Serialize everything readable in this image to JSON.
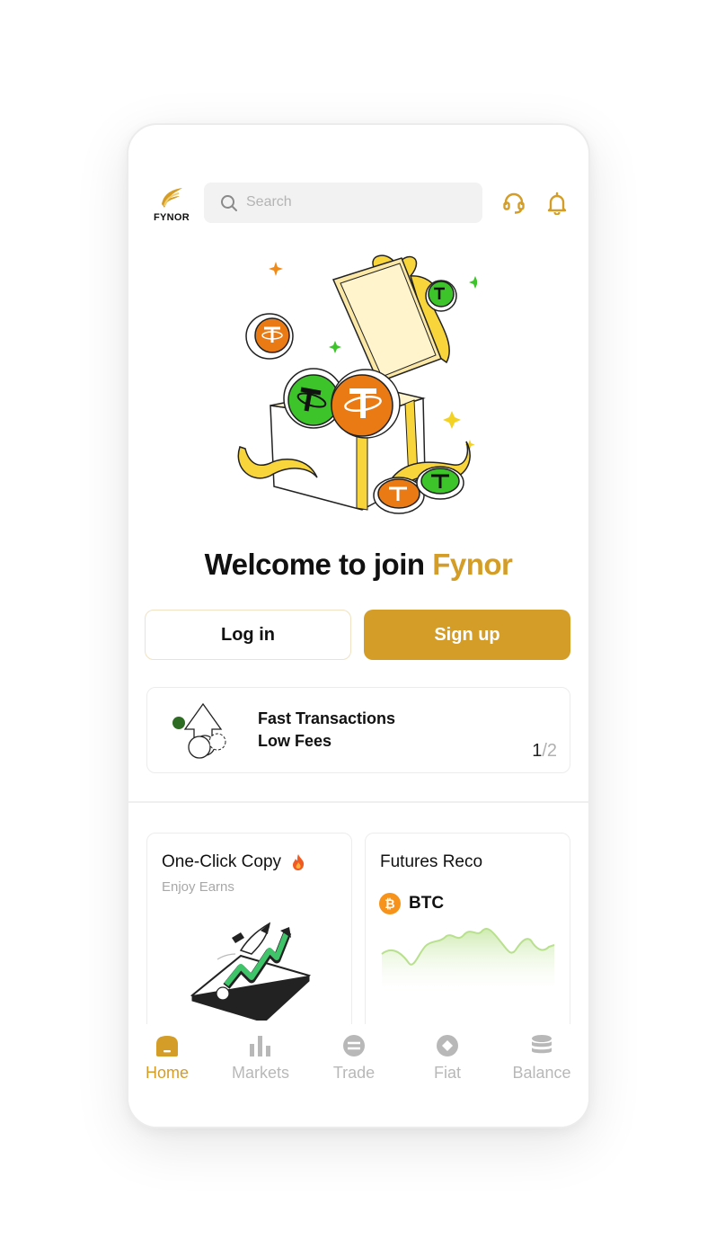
{
  "app": {
    "logo_text": "FYNOR"
  },
  "search": {
    "placeholder": "Search",
    "icon": "search-icon"
  },
  "header_icons": [
    "headset-icon",
    "bell-icon"
  ],
  "welcome": {
    "prefix": "Welcome to join ",
    "brand": "Fynor"
  },
  "buttons": {
    "login": "Log in",
    "signup": "Sign up"
  },
  "promo": {
    "line1": "Fast Transactions",
    "line2": "Low Fees",
    "page_current": "1",
    "page_total": "/2"
  },
  "cards": {
    "copy": {
      "title": "One-Click Copy",
      "subtitle": "Enjoy Earns"
    },
    "futures": {
      "title": "Futures Reco",
      "coin": "BTC"
    }
  },
  "tabs": [
    {
      "label": "Home",
      "icon": "home-icon",
      "active": true
    },
    {
      "label": "Markets",
      "icon": "bar-chart-icon",
      "active": false
    },
    {
      "label": "Trade",
      "icon": "trade-icon",
      "active": false
    },
    {
      "label": "Fiat",
      "icon": "fiat-icon",
      "active": false
    },
    {
      "label": "Balance",
      "icon": "coins-stack-icon",
      "active": false
    }
  ],
  "colors": {
    "accent": "#d39d27",
    "tether_green": "#3ec42b",
    "tether_orange": "#ea7b14",
    "inactive_tab": "#b8b8b8"
  }
}
